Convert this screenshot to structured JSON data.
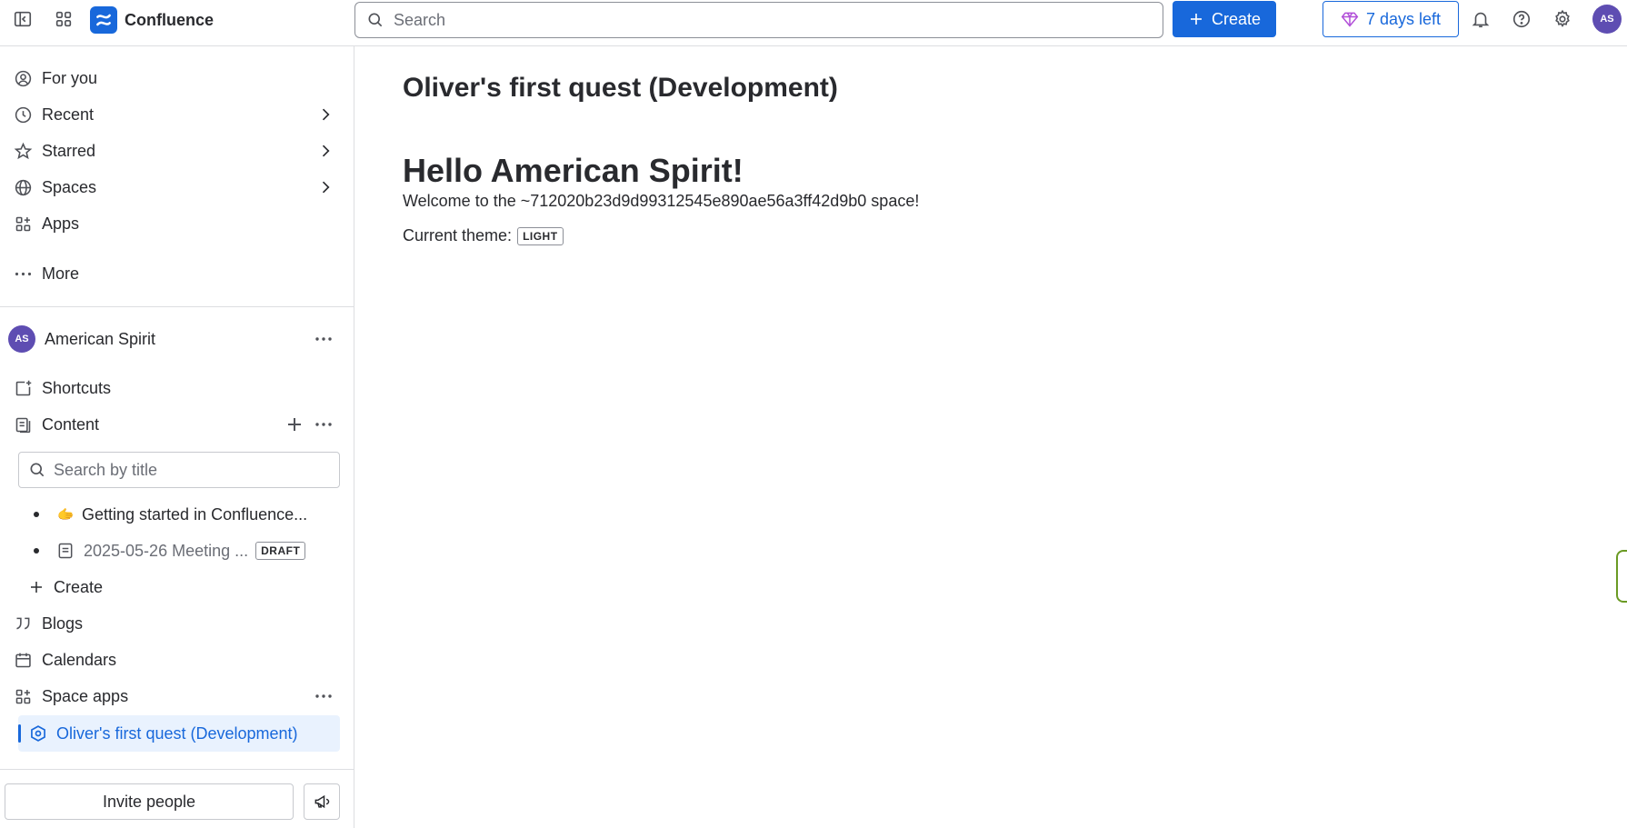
{
  "topbar": {
    "app_name": "Confluence",
    "search_placeholder": "Search",
    "create_label": "Create",
    "trial_label": "7 days left",
    "user_initials": "AS"
  },
  "sidebar": {
    "nav": [
      {
        "label": "For you",
        "icon": "user-circle-icon"
      },
      {
        "label": "Recent",
        "icon": "clock-icon"
      },
      {
        "label": "Starred",
        "icon": "star-icon"
      },
      {
        "label": "Spaces",
        "icon": "globe-icon"
      },
      {
        "label": "Apps",
        "icon": "apps-grid-icon"
      },
      {
        "label": "More",
        "icon": "more-icon"
      }
    ],
    "space": {
      "initials": "AS",
      "name": "American Spirit",
      "items": {
        "shortcuts": "Shortcuts",
        "content": "Content",
        "blogs": "Blogs",
        "calendars": "Calendars",
        "space_apps": "Space apps"
      },
      "title_search_placeholder": "Search by title",
      "tree": [
        {
          "emoji": "🫱",
          "label": "Getting started in Confluence..."
        },
        {
          "label": "2025-05-26 Meeting ...",
          "badge": "DRAFT"
        }
      ],
      "tree_create": "Create",
      "selected_app": "Oliver's first quest (Development)"
    },
    "invite_label": "Invite people"
  },
  "main": {
    "page_title": "Oliver's first quest (Development)",
    "heading": "Hello American Spirit!",
    "welcome": "Welcome to the ~712020b23d9d99312545e890ae56a3ff42d9b0 space!",
    "theme_label": "Current theme:",
    "theme_value": "LIGHT"
  },
  "colors": {
    "brand": "#1868db",
    "avatar": "#5e4db2",
    "selected_bg": "#e9f2fe"
  }
}
